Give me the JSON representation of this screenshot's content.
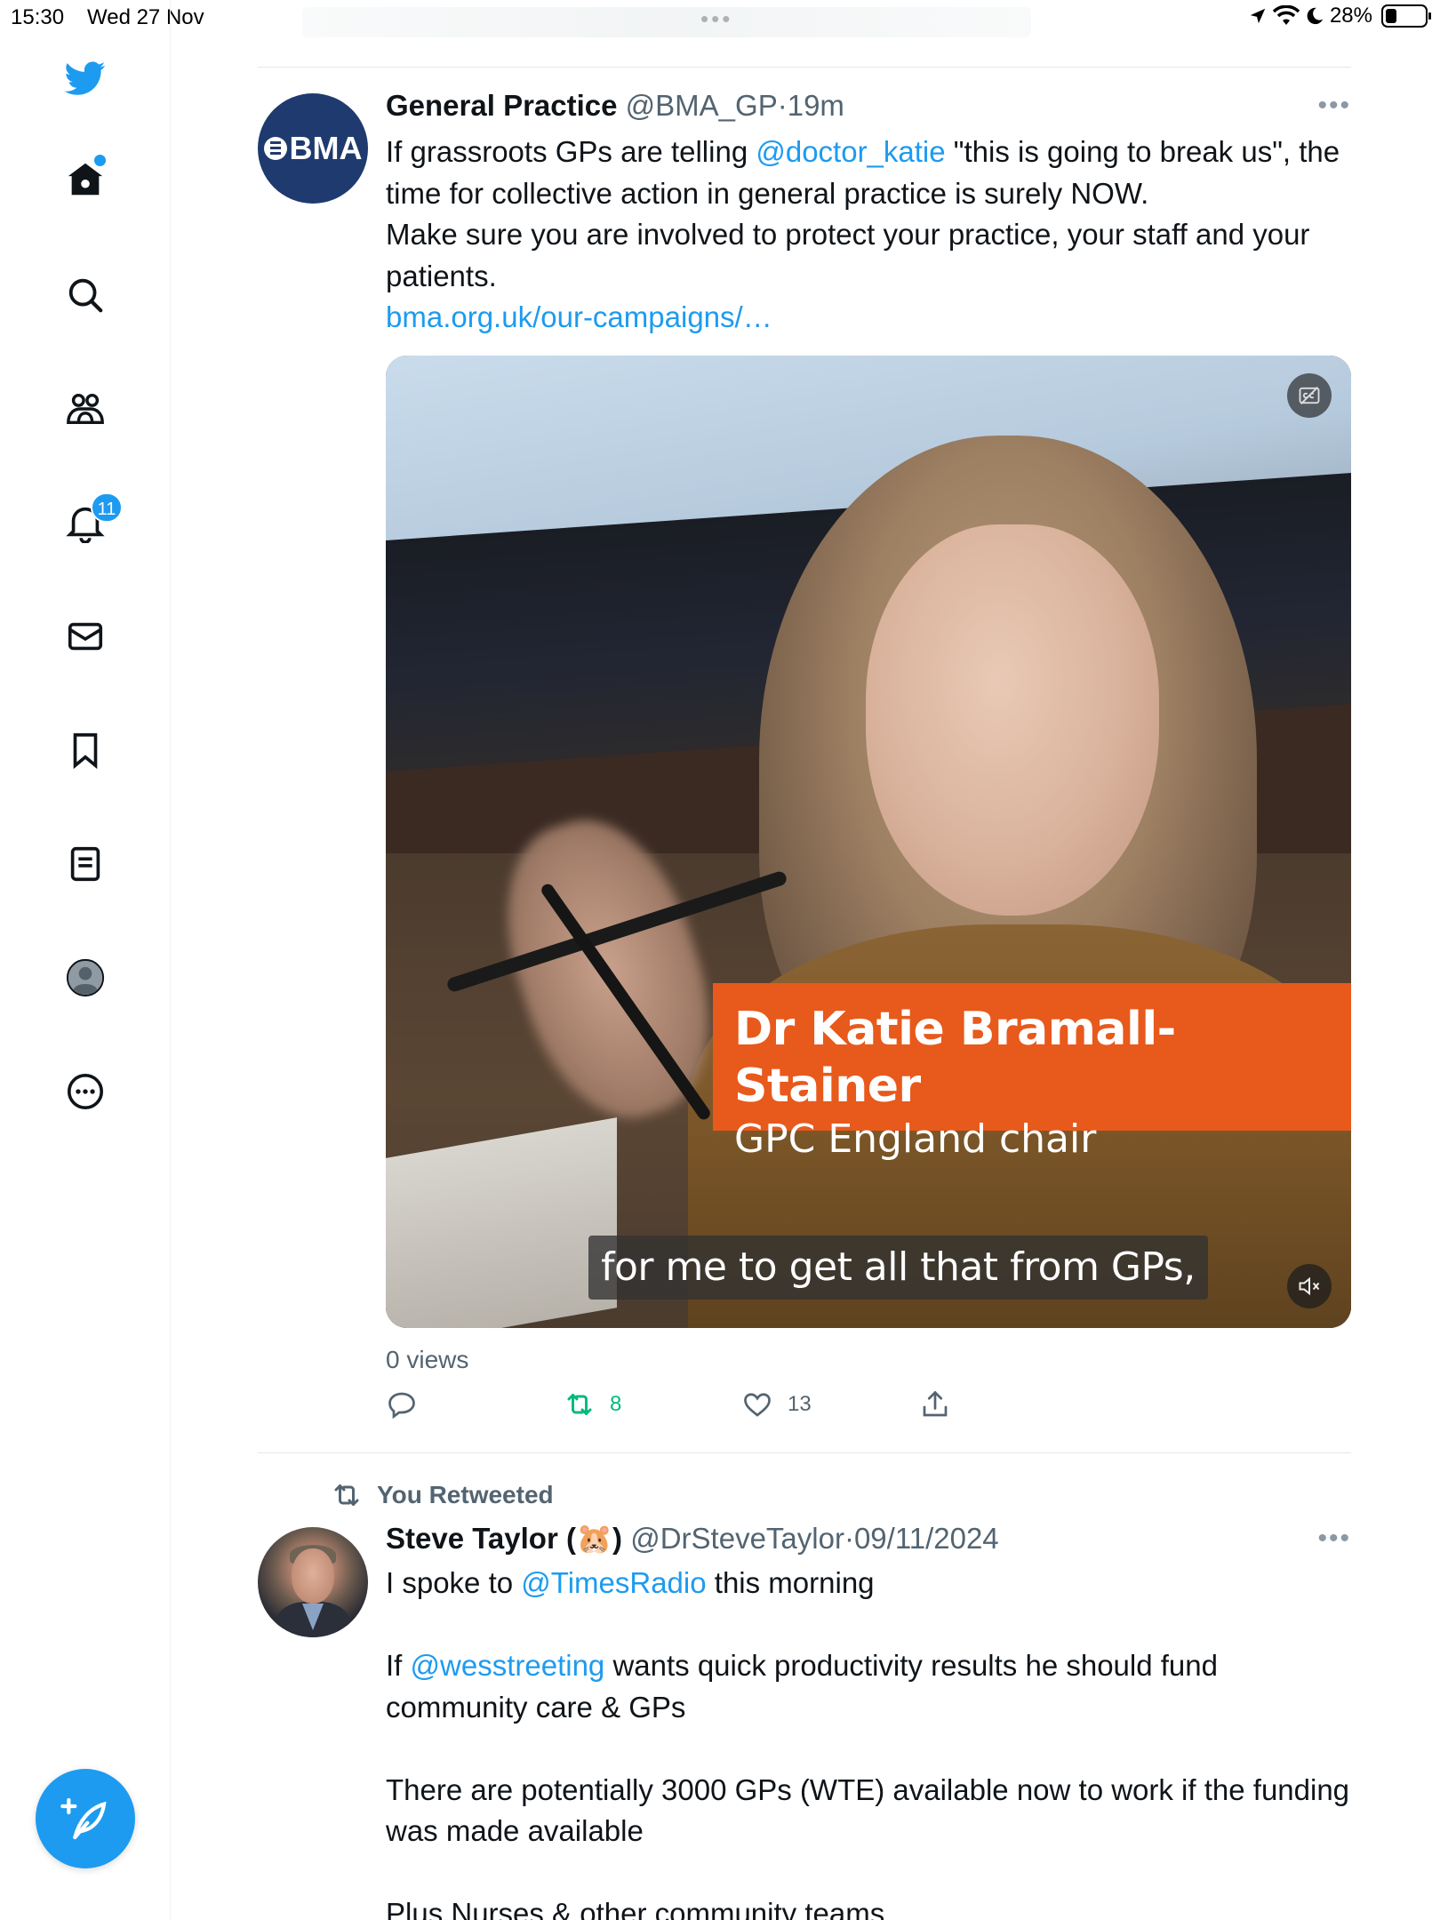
{
  "status_bar": {
    "time": "15:30",
    "date": "Wed 27 Nov",
    "battery": "28%",
    "battery_level": 0.28
  },
  "sidebar": {
    "items": [
      {
        "name": "home",
        "icon": "home-icon",
        "has_dot": true
      },
      {
        "name": "explore",
        "icon": "search-icon"
      },
      {
        "name": "communities",
        "icon": "communities-icon"
      },
      {
        "name": "notifications",
        "icon": "bell-icon",
        "badge": "11"
      },
      {
        "name": "messages",
        "icon": "envelope-icon"
      },
      {
        "name": "bookmarks",
        "icon": "bookmark-icon"
      },
      {
        "name": "lists",
        "icon": "list-icon"
      },
      {
        "name": "profile",
        "icon": "profile-avatar-icon"
      },
      {
        "name": "more",
        "icon": "more-circle-icon"
      }
    ],
    "logo": "twitter-bird-icon",
    "compose": "compose-tweet-icon"
  },
  "tweets": [
    {
      "display_name": "General Practice",
      "handle": "@BMA_GP",
      "separator": "·",
      "time": "19m",
      "avatar_text": "BMA",
      "text_segments": [
        {
          "type": "text",
          "value": "If grassroots GPs are telling "
        },
        {
          "type": "link",
          "value": "@doctor_katie"
        },
        {
          "type": "text",
          "value": " \"this is going to break us\", the time for collective action in general practice is surely NOW."
        }
      ],
      "line2": "Make sure you are involved to protect your practice, your staff and your patients.",
      "url": "bma.org.uk/our-campaigns/…",
      "media": {
        "lower_third_name": "Dr Katie Bramall-Stainer",
        "lower_third_title": "GPC England chair",
        "subtitle": "for me to get all that from GPs,",
        "cc_icon": "captions-icon",
        "mute_icon": "muted-speaker-icon"
      },
      "views": "0 views",
      "replies": "",
      "retweets": "8",
      "likes": "13",
      "retweeted_by_me": true
    },
    {
      "retweet_label": "You Retweeted",
      "display_name": "Steve Taylor (🐹)",
      "handle": "@DrSteveTaylor",
      "separator": "·",
      "time": "09/11/2024",
      "p1_pre": "I spoke to ",
      "p1_link": "@TimesRadio",
      "p1_post": " this morning",
      "p2_pre": "If ",
      "p2_link": "@wesstreeting",
      "p2_post": " wants quick productivity results he should fund community care & GPs",
      "p3": "There are potentially 3000 GPs (WTE) available now to work if the funding was made available",
      "p4": "Plus Nurses & other community teams"
    }
  ],
  "colors": {
    "accent": "#1d9bf0",
    "retweet_green": "#00ba7c",
    "bma_navy": "#1e3a6e",
    "lower_third_orange": "#e8591c"
  }
}
